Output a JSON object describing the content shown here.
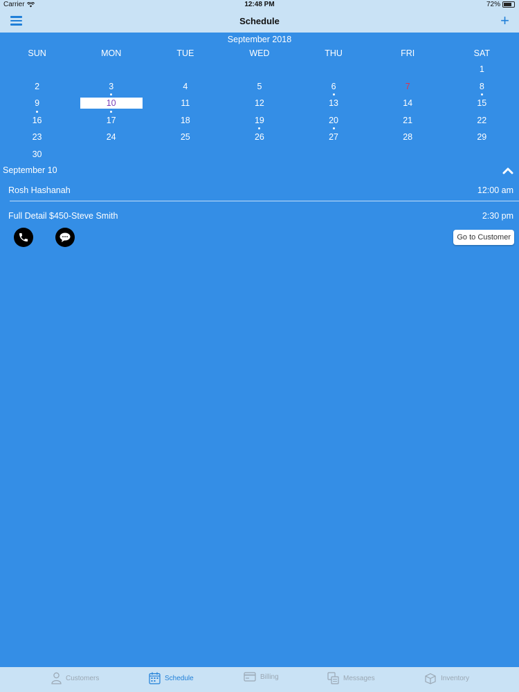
{
  "status": {
    "carrier": "Carrier",
    "time": "12:48 PM",
    "battery": "72%"
  },
  "nav": {
    "title": "Schedule",
    "add": "+"
  },
  "calendar": {
    "month": "September 2018",
    "weekdays": [
      "SUN",
      "MON",
      "TUE",
      "WED",
      "THU",
      "FRI",
      "SAT"
    ],
    "weeks": [
      [
        null,
        null,
        null,
        null,
        null,
        null,
        {
          "n": "1"
        }
      ],
      [
        {
          "n": "2"
        },
        {
          "n": "3",
          "dot": true
        },
        {
          "n": "4"
        },
        {
          "n": "5"
        },
        {
          "n": "6",
          "dot": true
        },
        {
          "n": "7",
          "holiday": true
        },
        {
          "n": "8",
          "dot": true
        }
      ],
      [
        {
          "n": "9",
          "dot": true
        },
        {
          "n": "10",
          "selected": true,
          "dot": true
        },
        {
          "n": "11"
        },
        {
          "n": "12"
        },
        {
          "n": "13"
        },
        {
          "n": "14"
        },
        {
          "n": "15"
        }
      ],
      [
        {
          "n": "16"
        },
        {
          "n": "17"
        },
        {
          "n": "18"
        },
        {
          "n": "19",
          "dot": true
        },
        {
          "n": "20",
          "dot": true
        },
        {
          "n": "21"
        },
        {
          "n": "22"
        }
      ],
      [
        {
          "n": "23"
        },
        {
          "n": "24"
        },
        {
          "n": "25"
        },
        {
          "n": "26"
        },
        {
          "n": "27"
        },
        {
          "n": "28"
        },
        {
          "n": "29"
        }
      ],
      [
        {
          "n": "30"
        },
        null,
        null,
        null,
        null,
        null,
        null
      ]
    ]
  },
  "selected_date": "September 10",
  "events": [
    {
      "title": "Rosh Hashanah",
      "time": "12:00 am"
    },
    {
      "title": "Full Detail $450-Steve Smith",
      "time": "2:30 pm"
    }
  ],
  "actions": {
    "go_to_customer": "Go to Customer"
  },
  "tabs": [
    {
      "label": "Customers",
      "icon": "person-icon"
    },
    {
      "label": "Schedule",
      "icon": "calendar-icon",
      "active": true
    },
    {
      "label": "Billing",
      "icon": "card-icon"
    },
    {
      "label": "Messages",
      "icon": "messages-icon"
    },
    {
      "label": "Inventory",
      "icon": "box-icon"
    }
  ],
  "colors": {
    "background": "#348ee6",
    "bar": "#c9e2f5",
    "accent": "#1f7fd8",
    "holiday": "#e0344a",
    "selected_text": "#7b3fb8"
  }
}
